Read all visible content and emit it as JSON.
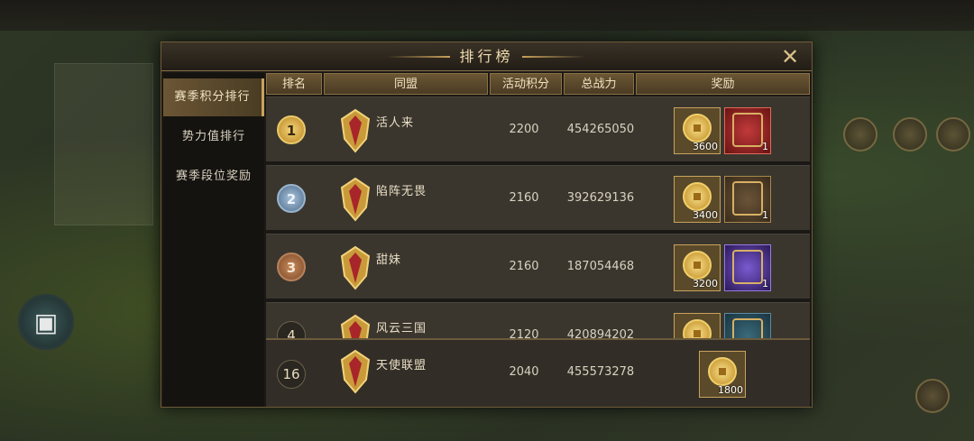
{
  "modal": {
    "title": "排行榜"
  },
  "tabs": [
    {
      "label": "赛季积分排行",
      "active": true
    },
    {
      "label": "势力值排行",
      "active": false
    },
    {
      "label": "赛季段位奖励",
      "active": false
    }
  ],
  "table": {
    "headers": [
      "排名",
      "同盟",
      "活动积分",
      "总战力",
      "奖励"
    ],
    "rows": [
      {
        "rank": "1",
        "alliance": "活人来",
        "points": "2200",
        "power": "454265050",
        "rewards": [
          {
            "icon": "gold-coin-icon",
            "qty": "3600"
          },
          {
            "icon": "red-frame-icon",
            "qty": "1"
          }
        ]
      },
      {
        "rank": "2",
        "alliance": "陷阵无畏",
        "points": "2160",
        "power": "392629136",
        "rewards": [
          {
            "icon": "gold-coin-icon",
            "qty": "3400"
          },
          {
            "icon": "bronze-frame-icon",
            "qty": "1"
          }
        ]
      },
      {
        "rank": "3",
        "alliance": "甜妹",
        "points": "2160",
        "power": "187054468",
        "rewards": [
          {
            "icon": "gold-coin-icon",
            "qty": "3200"
          },
          {
            "icon": "purple-frame-icon",
            "qty": "1"
          }
        ]
      },
      {
        "rank": "4",
        "alliance": "风云三国",
        "points": "2120",
        "power": "420894202",
        "rewards": [
          {
            "icon": "gold-coin-icon",
            "qty": ""
          },
          {
            "icon": "blue-frame-icon",
            "qty": ""
          }
        ]
      }
    ],
    "self_row": {
      "rank": "16",
      "alliance": "天使联盟",
      "points": "2040",
      "power": "455573278",
      "rewards": [
        {
          "icon": "gold-coin-icon",
          "qty": "1800"
        }
      ]
    }
  }
}
